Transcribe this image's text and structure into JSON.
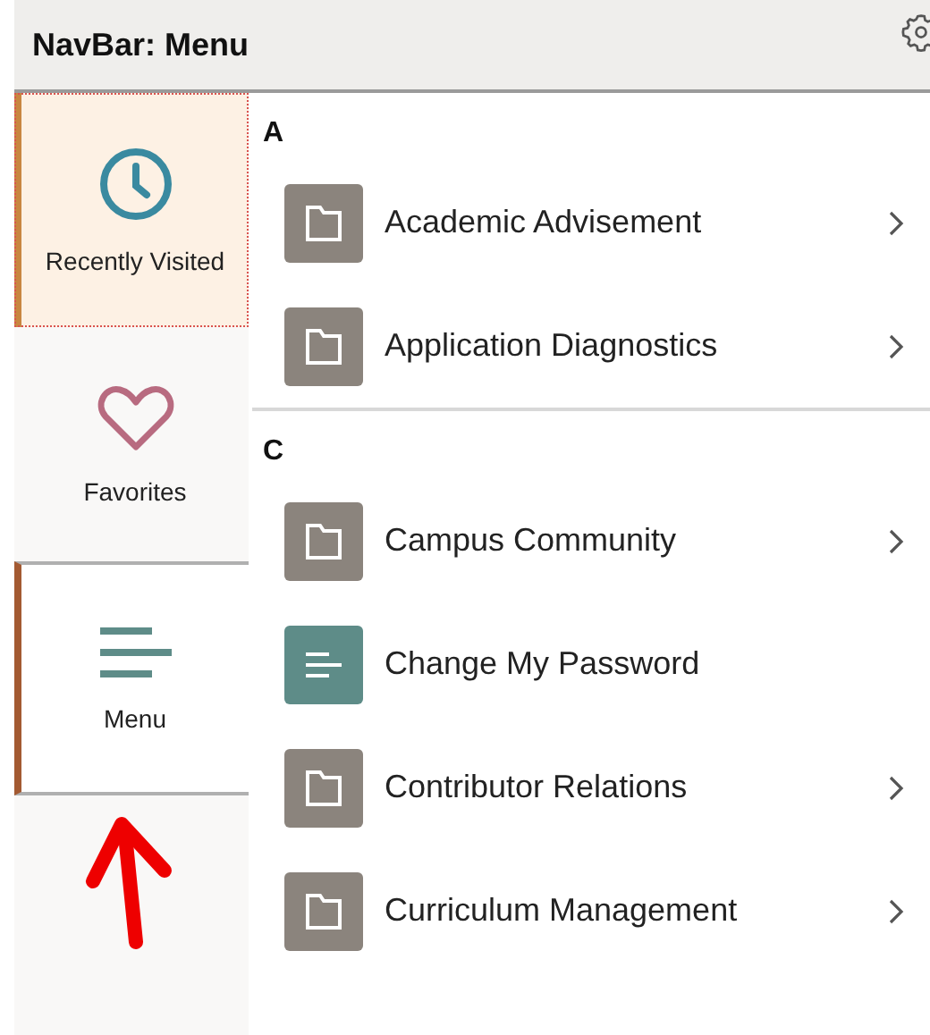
{
  "header": {
    "title": "NavBar: Menu"
  },
  "tabs": [
    {
      "label": "Recently Visited",
      "kind": "clock",
      "selected": false,
      "focused": true
    },
    {
      "label": "Favorites",
      "kind": "heart",
      "selected": false,
      "focused": false
    },
    {
      "label": "Menu",
      "kind": "menu",
      "selected": true,
      "focused": false
    }
  ],
  "sections": [
    {
      "letter": "A",
      "items": [
        {
          "label": "Academic Advisement",
          "kind": "folder",
          "has_children": true
        },
        {
          "label": "Application Diagnostics",
          "kind": "folder",
          "has_children": true
        }
      ]
    },
    {
      "letter": "C",
      "items": [
        {
          "label": "Campus Community",
          "kind": "folder",
          "has_children": true
        },
        {
          "label": "Change My Password",
          "kind": "page",
          "has_children": false
        },
        {
          "label": "Contributor Relations",
          "kind": "folder",
          "has_children": true
        },
        {
          "label": "Curriculum Management",
          "kind": "folder",
          "has_children": true
        }
      ]
    }
  ]
}
